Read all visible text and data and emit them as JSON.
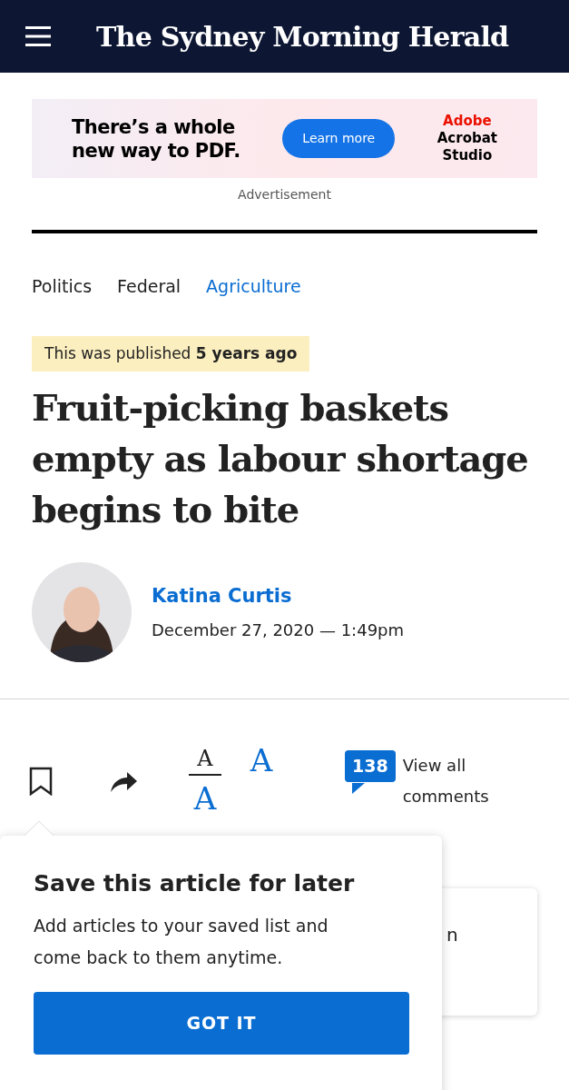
{
  "header": {
    "logo": "The Sydney Morning Herald"
  },
  "ad": {
    "headline_lines": [
      "There’s a whole",
      "new way to PDF."
    ],
    "button": "Learn more",
    "brand_lines": [
      "Adobe",
      "Acrobat",
      "Studio"
    ],
    "caption": "Advertisement"
  },
  "breadcrumbs": [
    {
      "label": "Politics",
      "selected": false
    },
    {
      "label": "Federal",
      "selected": false
    },
    {
      "label": "Agriculture",
      "selected": true
    }
  ],
  "notice": "This was published **5 years ago**",
  "headline": "Fruit-picking baskets empty as labour shortage begins to bite",
  "byline": {
    "author": "Katina Curtis",
    "date": "December 27, 2020 — 1:49pm"
  },
  "tools": {
    "text_sizes": [
      {
        "label": "A",
        "selected": true
      },
      {
        "label": "A",
        "selected": false
      },
      {
        "label": "A",
        "selected": false
      }
    ],
    "comment_count": "138",
    "comments_link": "View all comments"
  },
  "background_card": {
    "text": "n"
  },
  "popup": {
    "title": "Save this article for later",
    "body": "Add articles to your saved list and come back to them anytime.",
    "button": "GOT IT"
  }
}
